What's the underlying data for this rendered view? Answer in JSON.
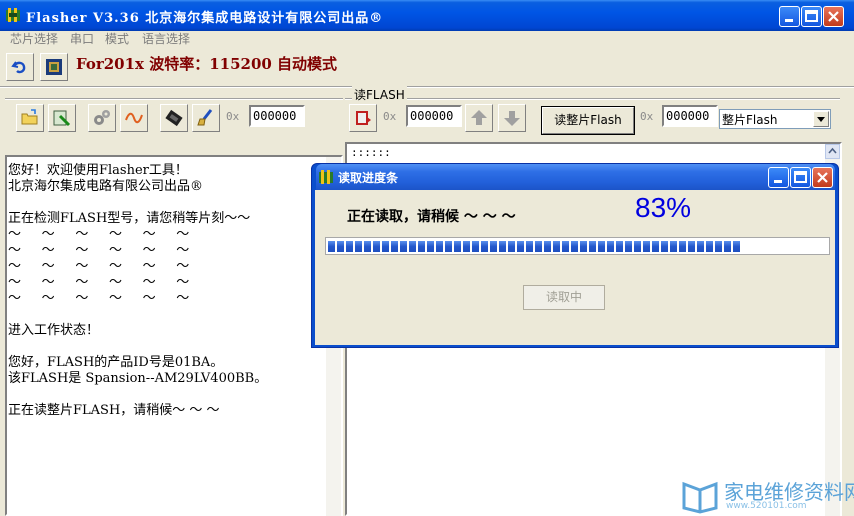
{
  "window": {
    "title": "Flasher V3.36  北京海尔集成电路设计有限公司出品®"
  },
  "menu": [
    {
      "label": "芯片选择"
    },
    {
      "label": "串口"
    },
    {
      "label": "模式"
    },
    {
      "label": "语言选择"
    }
  ],
  "toolbar": {
    "info": "For201x 波特率：115200 自动模式"
  },
  "left_panel": {
    "prefix": "0x",
    "address": "000000"
  },
  "right_panel": {
    "group_label": "读FLASH",
    "prefix1": "0x",
    "address1": "000000",
    "read_button": "读整片Flash",
    "prefix2": "0x",
    "address2": "000000",
    "mode_select": "整片Flash",
    "output_line": "::::::"
  },
  "log": [
    "您好！欢迎使用Flasher工具！",
    "北京海尔集成电路有限公司出品®",
    "",
    "正在检测FLASH型号，请您稍等片刻～～",
    "～     ～     ～     ～     ～     ～",
    "～     ～     ～     ～     ～     ～",
    "～     ～     ～     ～     ～     ～",
    "～     ～     ～     ～     ～     ～",
    "～     ～     ～     ～     ～     ～",
    "进入工作状态！",
    "",
    "您好，FLASH的产品ID号是01BA。",
    "该FLASH是 Spansion--AM29LV400BB。",
    "",
    "正在读整片FLASH，请稍候～ ～ ～"
  ],
  "dialog": {
    "title": "读取进度条",
    "status": "正在读取，请稍候 ～ ～ ～",
    "percent_text": "83%",
    "progress": 0.83,
    "button": "读取中"
  },
  "watermark": {
    "text": "家电维修资料网",
    "sub": "www.520101.com"
  }
}
